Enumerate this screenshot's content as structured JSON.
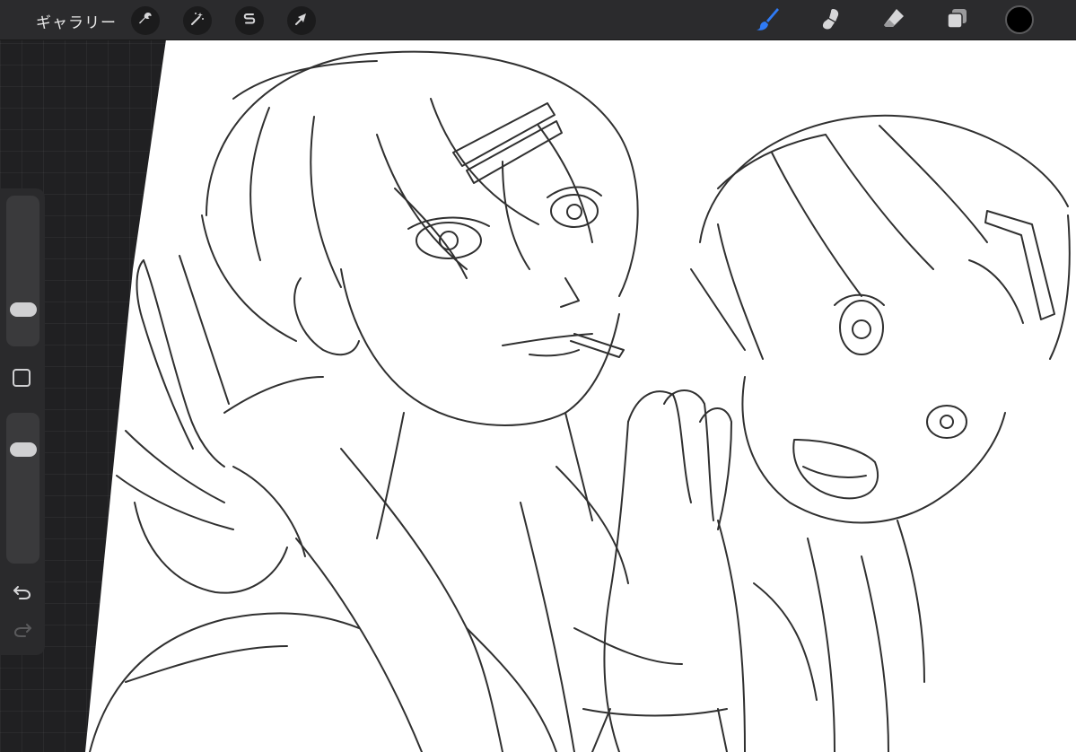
{
  "topbar": {
    "gallery_label": "ギャラリー",
    "left_tools": [
      {
        "name": "actions",
        "icon": "wrench-icon"
      },
      {
        "name": "adjustments",
        "icon": "magic-wand-icon"
      },
      {
        "name": "selection",
        "icon": "selection-s-icon"
      },
      {
        "name": "transform",
        "icon": "arrow-cursor-icon"
      }
    ],
    "right_tools": [
      {
        "name": "brush",
        "icon": "brush-icon",
        "active": true
      },
      {
        "name": "smudge",
        "icon": "smudge-icon",
        "active": false
      },
      {
        "name": "eraser",
        "icon": "eraser-icon",
        "active": false
      },
      {
        "name": "layers",
        "icon": "layers-icon",
        "active": false
      }
    ],
    "current_color": "#000000"
  },
  "sidebar": {
    "brush_size_level": 0.2,
    "opacity_level": 0.8,
    "icons": {
      "modify": "square-modify-icon",
      "undo": "undo-icon",
      "redo": "redo-icon"
    }
  },
  "colors": {
    "active_tool": "#2f7bf6",
    "icon_default": "#d6d6d8",
    "paper": "#ffffff",
    "ink": "#1a1a1a"
  }
}
